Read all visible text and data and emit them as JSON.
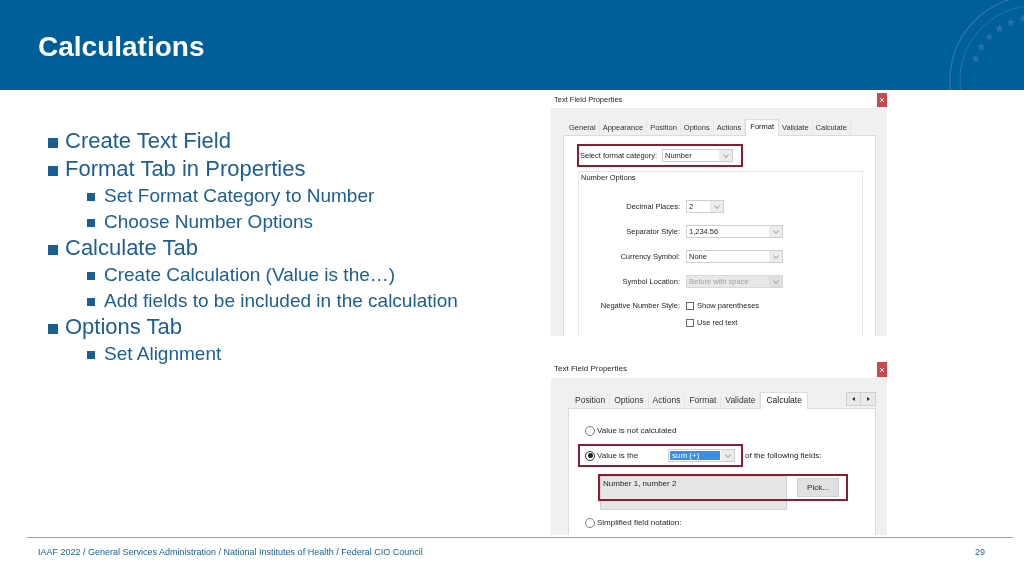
{
  "header": {
    "title": "Calculations"
  },
  "bullets": [
    {
      "text": "Create Text Field"
    },
    {
      "text": "Format Tab in Properties",
      "children": [
        {
          "text": "Set Format Category to Number"
        },
        {
          "text": "Choose Number Options"
        }
      ]
    },
    {
      "text": "Calculate Tab",
      "children": [
        {
          "text": "Create Calculation (Value is the…)"
        },
        {
          "text": "Add fields to be included in the calculation"
        }
      ]
    },
    {
      "text": "Options Tab",
      "children": [
        {
          "text": "Set Alignment"
        }
      ]
    }
  ],
  "format_dialog": {
    "title": "Text Field Properties",
    "tabs": [
      {
        "label": "General",
        "selected": false
      },
      {
        "label": "Appearance",
        "selected": false
      },
      {
        "label": "Position",
        "selected": false
      },
      {
        "label": "Options",
        "selected": false
      },
      {
        "label": "Actions",
        "selected": false
      },
      {
        "label": "Format",
        "selected": true
      },
      {
        "label": "Validate",
        "selected": false
      },
      {
        "label": "Calculate",
        "selected": false
      }
    ],
    "category": {
      "label": "Select format category:",
      "value": "Number",
      "highlighted": true
    },
    "group": {
      "title": "Number Options",
      "rows": [
        {
          "kind": "small_dropdown",
          "label": "Decimal Places:",
          "value": "2",
          "disabled": false
        },
        {
          "kind": "dropdown",
          "label": "Separator Style:",
          "value": "1,234.56",
          "disabled": false
        },
        {
          "kind": "dropdown",
          "label": "Currency Symbol:",
          "value": "None",
          "disabled": false
        },
        {
          "kind": "dropdown",
          "label": "Symbol Location:",
          "value": "Before with space",
          "disabled": true
        },
        {
          "kind": "checkboxes",
          "label": "Negative Number Style:",
          "options": [
            {
              "label": "Show parentheses",
              "checked": false
            },
            {
              "label": "Use red text",
              "checked": false
            }
          ]
        }
      ]
    }
  },
  "calculate_dialog": {
    "title": "Text Field Properties",
    "tabs": [
      {
        "label": "Position",
        "selected": false
      },
      {
        "label": "Options",
        "selected": false
      },
      {
        "label": "Actions",
        "selected": false
      },
      {
        "label": "Format",
        "selected": false
      },
      {
        "label": "Validate",
        "selected": false
      },
      {
        "label": "Calculate",
        "selected": true
      }
    ],
    "options": [
      {
        "kind": "plain",
        "label": "Value is not calculated",
        "selected": false
      },
      {
        "kind": "function",
        "label": "Value is the",
        "selected": true,
        "highlighted": true,
        "function": {
          "value": "sum (+)",
          "focused": true
        },
        "suffix": "of the following fields:",
        "fields": {
          "value": "Number 1, number 2",
          "button": "Pick...",
          "highlighted": true
        }
      },
      {
        "kind": "plain",
        "label": "Simplified field notation:",
        "selected": false
      }
    ]
  },
  "footer": {
    "text": "IAAF 2022 / General Services Administration / National Institutes of Health / Federal CIO Council",
    "page": "29"
  }
}
